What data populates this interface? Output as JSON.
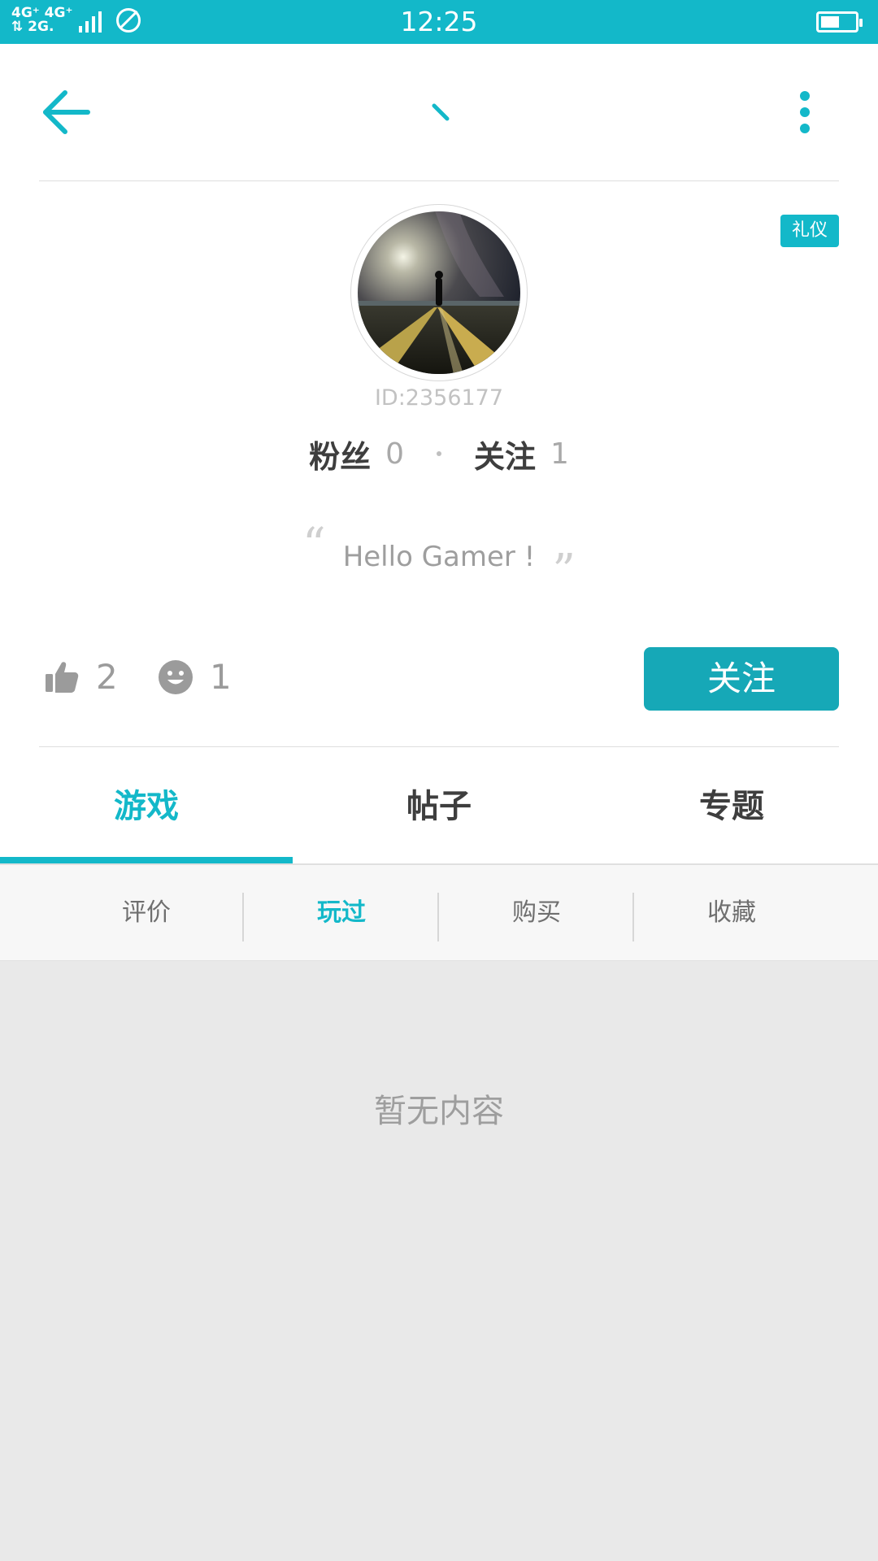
{
  "status_bar": {
    "network_line1": "4G⁺ 4G⁺",
    "network_line2": "⇅ 2G.",
    "time": "12:25",
    "battery_level": 0.55
  },
  "header": {
    "back_icon": "arrow-left-icon",
    "title": "、",
    "more_icon": "more-vertical-icon"
  },
  "profile": {
    "badge": "礼仪",
    "avatar": "avatar-night-road-photo",
    "user_id": "ID:2356177",
    "fans_label": "粉丝",
    "fans_count": "0",
    "following_label": "关注",
    "following_count": "1",
    "bio": "Hello Gamer !"
  },
  "actions": {
    "like_icon": "thumbs-up-icon",
    "like_count": "2",
    "smile_icon": "smile-icon",
    "smile_count": "1",
    "follow_button": "关注"
  },
  "tabs": [
    {
      "label": "游戏",
      "active": true
    },
    {
      "label": "帖子",
      "active": false
    },
    {
      "label": "专题",
      "active": false
    }
  ],
  "subtabs": [
    {
      "label": "评价",
      "active": false
    },
    {
      "label": "玩过",
      "active": true
    },
    {
      "label": "购买",
      "active": false
    },
    {
      "label": "收藏",
      "active": false
    }
  ],
  "empty_text": "暂无内容",
  "colors": {
    "accent": "#13b8c9",
    "button": "#16a8b7",
    "content_bg": "#e9e9e9"
  }
}
